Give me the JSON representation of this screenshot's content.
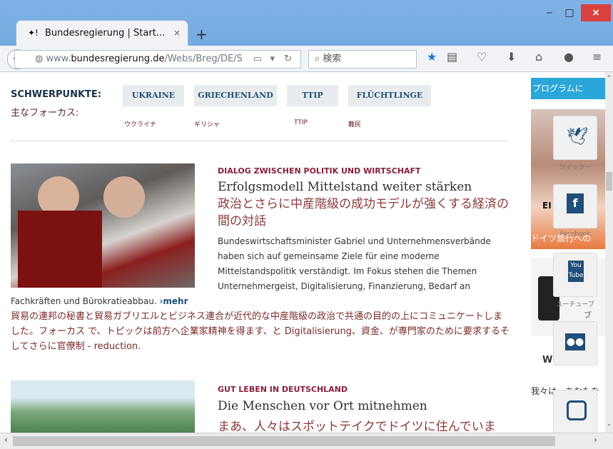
{
  "browser": {
    "tab_title": "Bundesregierung | Start...",
    "tab_close": "×",
    "new_tab": "+",
    "window_buttons": {
      "minimize": "‒",
      "maximize": "□",
      "close": "×"
    },
    "url_prefix": "www.",
    "url_domain": "bundesregierung.de",
    "url_path": "/Webs/Breg/DE/S",
    "search_placeholder": "検索"
  },
  "schwerpunkte": {
    "label": "SCHWERPUNKTE:",
    "label_jp": "主なフォーカス:",
    "topics": [
      {
        "label": "UKRAINE",
        "jp": "ウクライナ"
      },
      {
        "label": "GRIECHENLAND",
        "jp": "ギリシャ"
      },
      {
        "label": "TTIP",
        "jp": "TTIP"
      },
      {
        "label": "FLÜCHTLINGE",
        "jp": "難民"
      }
    ]
  },
  "article1": {
    "kicker": "DIALOG ZWISCHEN POLITIK UND WIRTSCHAFT",
    "title": "Erfolgsmodell Mittelstand weiter stärken",
    "title_jp": "政治とさらに中産階級の成功モデルが強くする経済の間の対話",
    "body": "Bundeswirtschaftsminister Gabriel und Unternehmensverbände haben sich auf gemeinsame Ziele für eine moderne Mittelstandspolitik verständigt. Im Fokus stehen die Themen Unternehmergeist, Digitalisierung, Finanzierung, Bedarf an Fachkräften und Bürokratieabbau.",
    "more": "›mehr",
    "body_jp": "貿易の連邦の秘書と貿易ガブリエルとビジネス連合が近代的な中産階級の政治で共通の目的の上にコミュニケートしました。フォーカス で、トピックは前方へ企業家精神を得ます、と Digitalisierung、資金、が専門家のために要求するそしてさらに官僚制 - reduction."
  },
  "article2": {
    "kicker": "GUT LEBEN IN DEUTSCHLAND",
    "title": "Die Menschen vor Ort mitnehmen",
    "title_jp": "まあ、人々はスポットテイクでドイツに住んでいま"
  },
  "sidebar": {
    "programm_label": "プログラムに",
    "banner_text": "EI",
    "tour_jp": "ドイツ旅行への",
    "video_label": "ブ",
    "wi_text": "WI",
    "bottom_jp": "我々は、あなたを"
  },
  "social": [
    {
      "name": "twitter",
      "label": "ツイッター"
    },
    {
      "name": "facebook",
      "label": "Facebook"
    },
    {
      "name": "youtube",
      "label": "ユーチューブ"
    },
    {
      "name": "flickr",
      "label": ""
    },
    {
      "name": "instagram",
      "label": ""
    }
  ]
}
